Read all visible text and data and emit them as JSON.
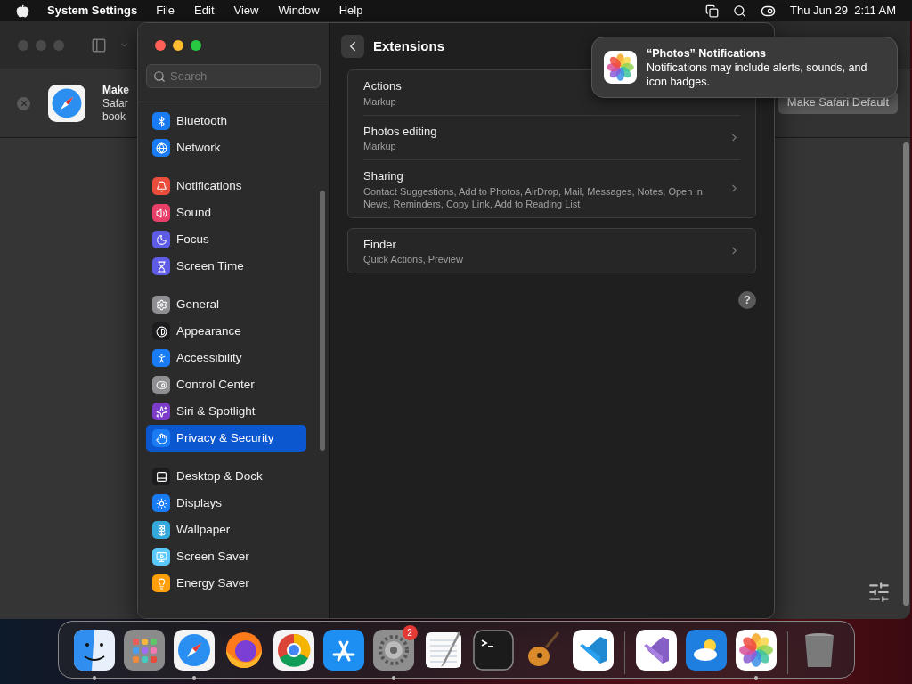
{
  "menu_bar": {
    "app_name": "System Settings",
    "menus": [
      "File",
      "Edit",
      "View",
      "Window",
      "Help"
    ],
    "clock": "Thu Jun 29  2:11 AM"
  },
  "background_window": {
    "banner": {
      "title": "Make",
      "line_1": "Safar",
      "line_2": "book",
      "button": "Make Safari Default"
    }
  },
  "settings": {
    "search": {
      "placeholder": "Search"
    },
    "sidebar_groups": [
      [
        {
          "label": "Bluetooth",
          "kind": "bluetooth",
          "color": "#1a7cf5",
          "selected": false
        },
        {
          "label": "Network",
          "kind": "network",
          "color": "#1a7cf5",
          "selected": false
        }
      ],
      [
        {
          "label": "Notifications",
          "kind": "notifications",
          "color": "#eb4d3d",
          "selected": false
        },
        {
          "label": "Sound",
          "kind": "sound",
          "color": "#e9406a",
          "selected": false
        },
        {
          "label": "Focus",
          "kind": "focus",
          "color": "#5e5ce6",
          "selected": false
        },
        {
          "label": "Screen Time",
          "kind": "screen-time",
          "color": "#5e5ce6",
          "selected": false
        }
      ],
      [
        {
          "label": "General",
          "kind": "general",
          "color": "#8e8e93",
          "selected": false
        },
        {
          "label": "Appearance",
          "kind": "appearance",
          "color": "#1c1c1e",
          "selected": false
        },
        {
          "label": "Accessibility",
          "kind": "accessibility",
          "color": "#1a7cf5",
          "selected": false
        },
        {
          "label": "Control Center",
          "kind": "control-center",
          "color": "#8e8e93",
          "selected": false
        },
        {
          "label": "Siri & Spotlight",
          "kind": "siri",
          "color": "#7d3cc8",
          "selected": false
        },
        {
          "label": "Privacy & Security",
          "kind": "privacy",
          "color": "#1a7cf5",
          "selected": true
        }
      ],
      [
        {
          "label": "Desktop & Dock",
          "kind": "desktop",
          "color": "#1c1c1e",
          "selected": false
        },
        {
          "label": "Displays",
          "kind": "displays",
          "color": "#1a7cf5",
          "selected": false
        },
        {
          "label": "Wallpaper",
          "kind": "wallpaper",
          "color": "#34aadc",
          "selected": false
        },
        {
          "label": "Screen Saver",
          "kind": "screen-saver",
          "color": "#5ac8fa",
          "selected": false
        },
        {
          "label": "Energy Saver",
          "kind": "energy",
          "color": "#ff9f0a",
          "selected": false
        }
      ]
    ],
    "page_title": "Extensions",
    "groups": [
      [
        {
          "title": "Actions",
          "detail": "Markup"
        },
        {
          "title": "Photos editing",
          "detail": "Markup"
        },
        {
          "title": "Sharing",
          "detail": "Contact Suggestions, Add to Photos, AirDrop, Mail, Messages, Notes, Open in News, Reminders, Copy Link, Add to Reading List"
        }
      ],
      [
        {
          "title": "Finder",
          "detail": "Quick Actions, Preview"
        }
      ]
    ],
    "help_button": "?"
  },
  "notification": {
    "title": "“Photos” Notifications",
    "body": "Notifications may include alerts, sounds, and icon badges."
  },
  "dock": {
    "items": [
      {
        "kind": "finder",
        "running": true
      },
      {
        "kind": "launchpad",
        "running": false
      },
      {
        "kind": "safari",
        "running": true
      },
      {
        "kind": "firefox",
        "running": false
      },
      {
        "kind": "chrome",
        "running": false
      },
      {
        "kind": "app-store",
        "running": false
      },
      {
        "kind": "settings",
        "running": true,
        "badge": "2"
      },
      {
        "kind": "text-editor",
        "running": false
      },
      {
        "kind": "terminal",
        "running": false
      },
      {
        "kind": "guitar",
        "running": false
      },
      {
        "kind": "code-editor",
        "running": false
      },
      {
        "kind": "divider"
      },
      {
        "kind": "ide",
        "running": false
      },
      {
        "kind": "weather",
        "running": false
      },
      {
        "kind": "photos",
        "running": true
      },
      {
        "kind": "divider"
      },
      {
        "kind": "trash",
        "running": false
      }
    ]
  }
}
